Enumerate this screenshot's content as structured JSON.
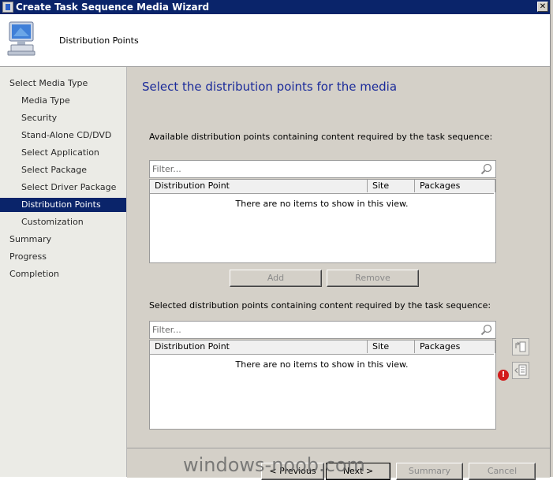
{
  "window": {
    "title": "Create Task Sequence Media Wizard",
    "close_label": "✕"
  },
  "header": {
    "title": "Distribution Points"
  },
  "nav": {
    "items": [
      {
        "label": "Select Media Type",
        "level": 0,
        "selected": false
      },
      {
        "label": "Media Type",
        "level": 1,
        "selected": false
      },
      {
        "label": "Security",
        "level": 1,
        "selected": false
      },
      {
        "label": "Stand-Alone CD/DVD",
        "level": 1,
        "selected": false
      },
      {
        "label": "Select Application",
        "level": 1,
        "selected": false
      },
      {
        "label": "Select Package",
        "level": 1,
        "selected": false
      },
      {
        "label": "Select Driver Package",
        "level": 1,
        "selected": false
      },
      {
        "label": "Distribution Points",
        "level": 1,
        "selected": true
      },
      {
        "label": "Customization",
        "level": 1,
        "selected": false
      },
      {
        "label": "Summary",
        "level": 0,
        "selected": false
      },
      {
        "label": "Progress",
        "level": 0,
        "selected": false
      },
      {
        "label": "Completion",
        "level": 0,
        "selected": false
      }
    ]
  },
  "main": {
    "heading": "Select the distribution points for the media",
    "available": {
      "label": "Available distribution points containing content required by the task sequence:",
      "filter_placeholder": "Filter...",
      "columns": [
        "Distribution Point",
        "Site",
        "Packages"
      ],
      "empty_text": "There are no items to show in this view."
    },
    "buttons": {
      "add": "Add",
      "remove": "Remove"
    },
    "selected": {
      "label": "Selected distribution points containing content required by the task sequence:",
      "filter_placeholder": "Filter...",
      "columns": [
        "Distribution Point",
        "Site",
        "Packages"
      ],
      "empty_text": "There are no items to show in this view."
    },
    "error_glyph": "!"
  },
  "footer": {
    "previous": "< Previous",
    "next": "Next >",
    "summary": "Summary",
    "cancel": "Cancel"
  },
  "watermark": "windows-noob.com",
  "colors": {
    "titlebar": "#0a246a",
    "selected_nav": "#0a246a",
    "heading": "#1a2a9a",
    "error": "#d21a1a"
  }
}
